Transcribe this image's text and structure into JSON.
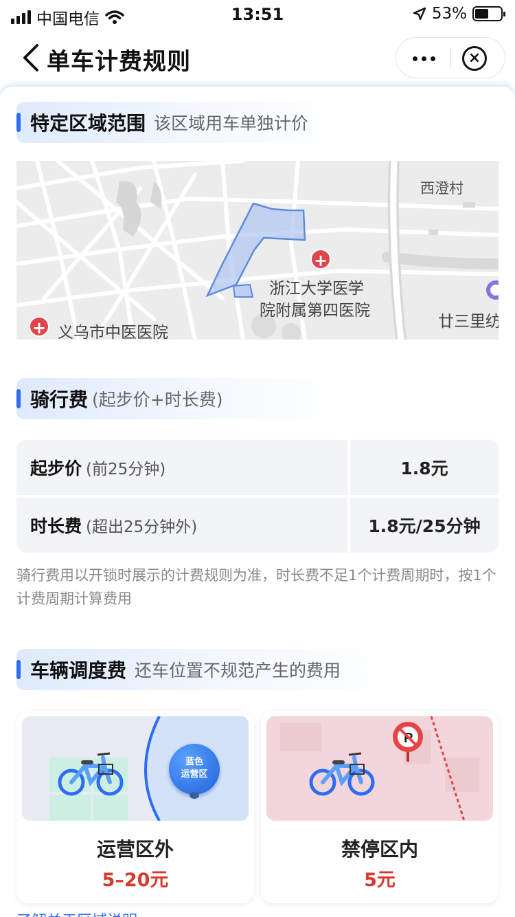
{
  "status_bar": {
    "carrier": "中国电信",
    "time": "13:51",
    "battery_percent": "53%",
    "battery_level": 0.53
  },
  "nav": {
    "title": "单车计费规则"
  },
  "zone_section": {
    "title": "特定区域范围",
    "subtitle": "该区域用车单独计价",
    "map_labels": {
      "village": "西澄村",
      "hospital_1_line1": "浙江大学医学",
      "hospital_1_line2": "院附属第四医院",
      "hospital_2": "义乌市中医医院",
      "place_3": "廿三里纺"
    }
  },
  "riding_section": {
    "title": "骑行费",
    "subtitle": "(起步价+时长费)",
    "rows": [
      {
        "label": "起步价",
        "hint": "(前25分钟)",
        "value": "1.8元"
      },
      {
        "label": "时长费",
        "hint": "(超出25分钟外)",
        "value": "1.8元/25分钟"
      }
    ],
    "note": "骑行费用以开锁时展示的计费规则为准，时长费不足1个计费周期时，按1个计费周期计算费用"
  },
  "dispatch_section": {
    "title": "车辆调度费",
    "subtitle": "还车位置不规范产生的费用",
    "cards": [
      {
        "title": "运营区外",
        "price": "5–20元",
        "bubble_line1": "蓝色",
        "bubble_line2": "运营区"
      },
      {
        "title": "禁停区内",
        "price": "5元"
      }
    ],
    "bottom_link": "了解关于区域说明 >"
  },
  "colors": {
    "accent": "#2d6cf6",
    "price_red": "#d8392c",
    "zone_fill": "#b4c8f0"
  }
}
